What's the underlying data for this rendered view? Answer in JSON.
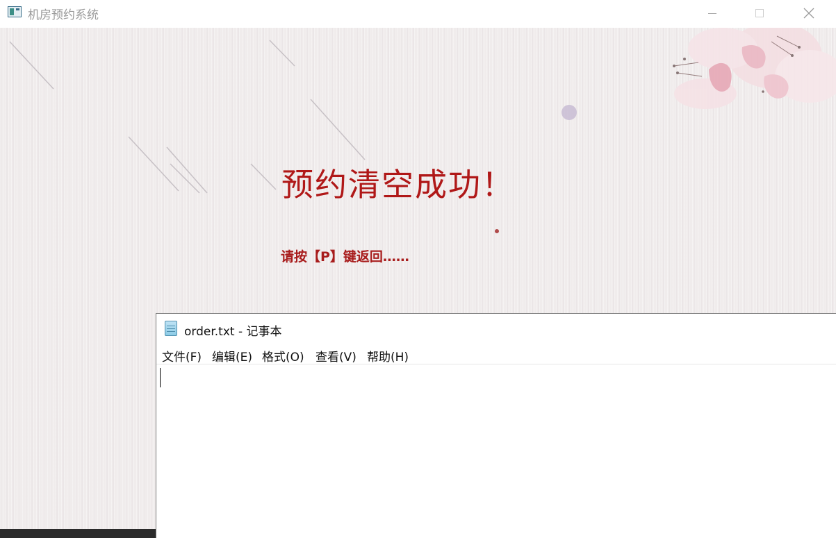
{
  "app": {
    "title": "机房预约系统",
    "message": "预约清空成功！",
    "hint": "请按【P】键返回……"
  },
  "notepad": {
    "title": "order.txt - 记事本",
    "menu": [
      "文件(F)",
      "编辑(E)",
      "格式(O)",
      "查看(V)",
      "帮助(H)"
    ],
    "content": ""
  },
  "colors": {
    "message": "#b01818",
    "hint": "#a81c1c",
    "background": "#f0ecec"
  },
  "icons": {
    "app": "window-app-icon",
    "notepad": "notepad-icon",
    "minimize": "minimize-icon",
    "maximize": "maximize-icon",
    "close": "close-icon"
  }
}
